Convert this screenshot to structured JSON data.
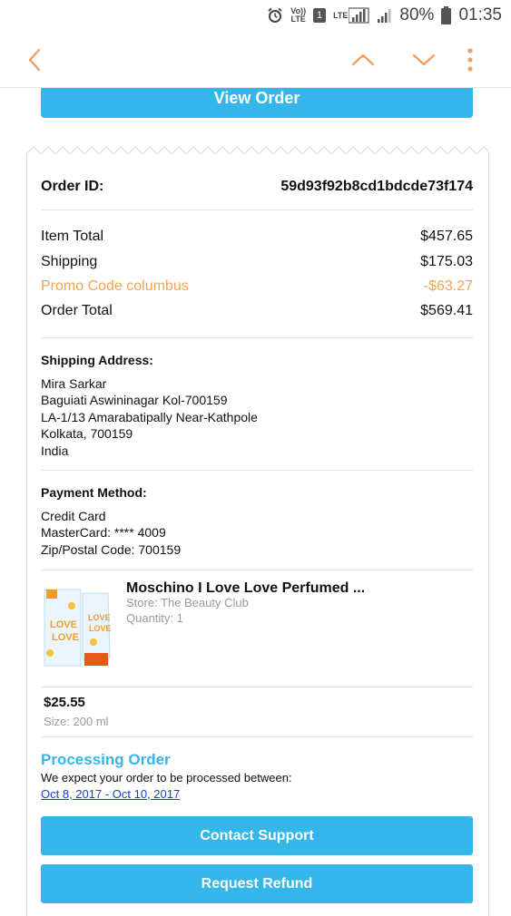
{
  "status_bar": {
    "volte_label": "Vo))\nLTE",
    "sim_slot": "1",
    "network_label": "LTE",
    "battery_percent": "80%",
    "time": "01:35"
  },
  "toolbar": {
    "back_icon": "chevron-left-icon",
    "up_icon": "chevron-up-icon",
    "down_icon": "chevron-down-icon",
    "more_icon": "more-vertical-icon",
    "accent_color": "#f0a060"
  },
  "view_order_label": "View Order",
  "order": {
    "id_label": "Order ID:",
    "id_value": "59d93f92b8cd1bdcde73f174",
    "item_total_label": "Item Total",
    "item_total_value": "$457.65",
    "shipping_label": "Shipping",
    "shipping_value": "$175.03",
    "promo_label": "Promo Code columbus",
    "promo_value": "-$63.27",
    "order_total_label": "Order Total",
    "order_total_value": "$569.41"
  },
  "shipping_address": {
    "title": "Shipping Address:",
    "lines": [
      "Mira Sarkar",
      "Baguiati Aswininagar Kol-700159",
      "LA-1/13 Amarabatipally Near-Kathpole",
      "Kolkata, 700159",
      "India"
    ]
  },
  "payment": {
    "title": "Payment Method:",
    "lines": [
      "Credit Card",
      "MasterCard: **** 4009",
      "Zip/Postal Code: 700159"
    ]
  },
  "product": {
    "name": "Moschino I Love Love Perfumed ...",
    "store": "Store: The Beauty Club",
    "quantity": "Quantity: 1",
    "price": "$25.55",
    "size": "Size: 200 ml",
    "image_icon": "perfume-product-image"
  },
  "processing": {
    "title": "Processing Order",
    "text": "We expect your order to be processed between:",
    "dates": "Oct 8, 2017 - Oct 10, 2017"
  },
  "buttons": {
    "contact_support": "Contact Support",
    "request_refund": "Request Refund"
  },
  "colors": {
    "primary_blue": "#35b6ea",
    "promo_orange": "#f0a451",
    "link_blue": "#1a3fd1"
  }
}
